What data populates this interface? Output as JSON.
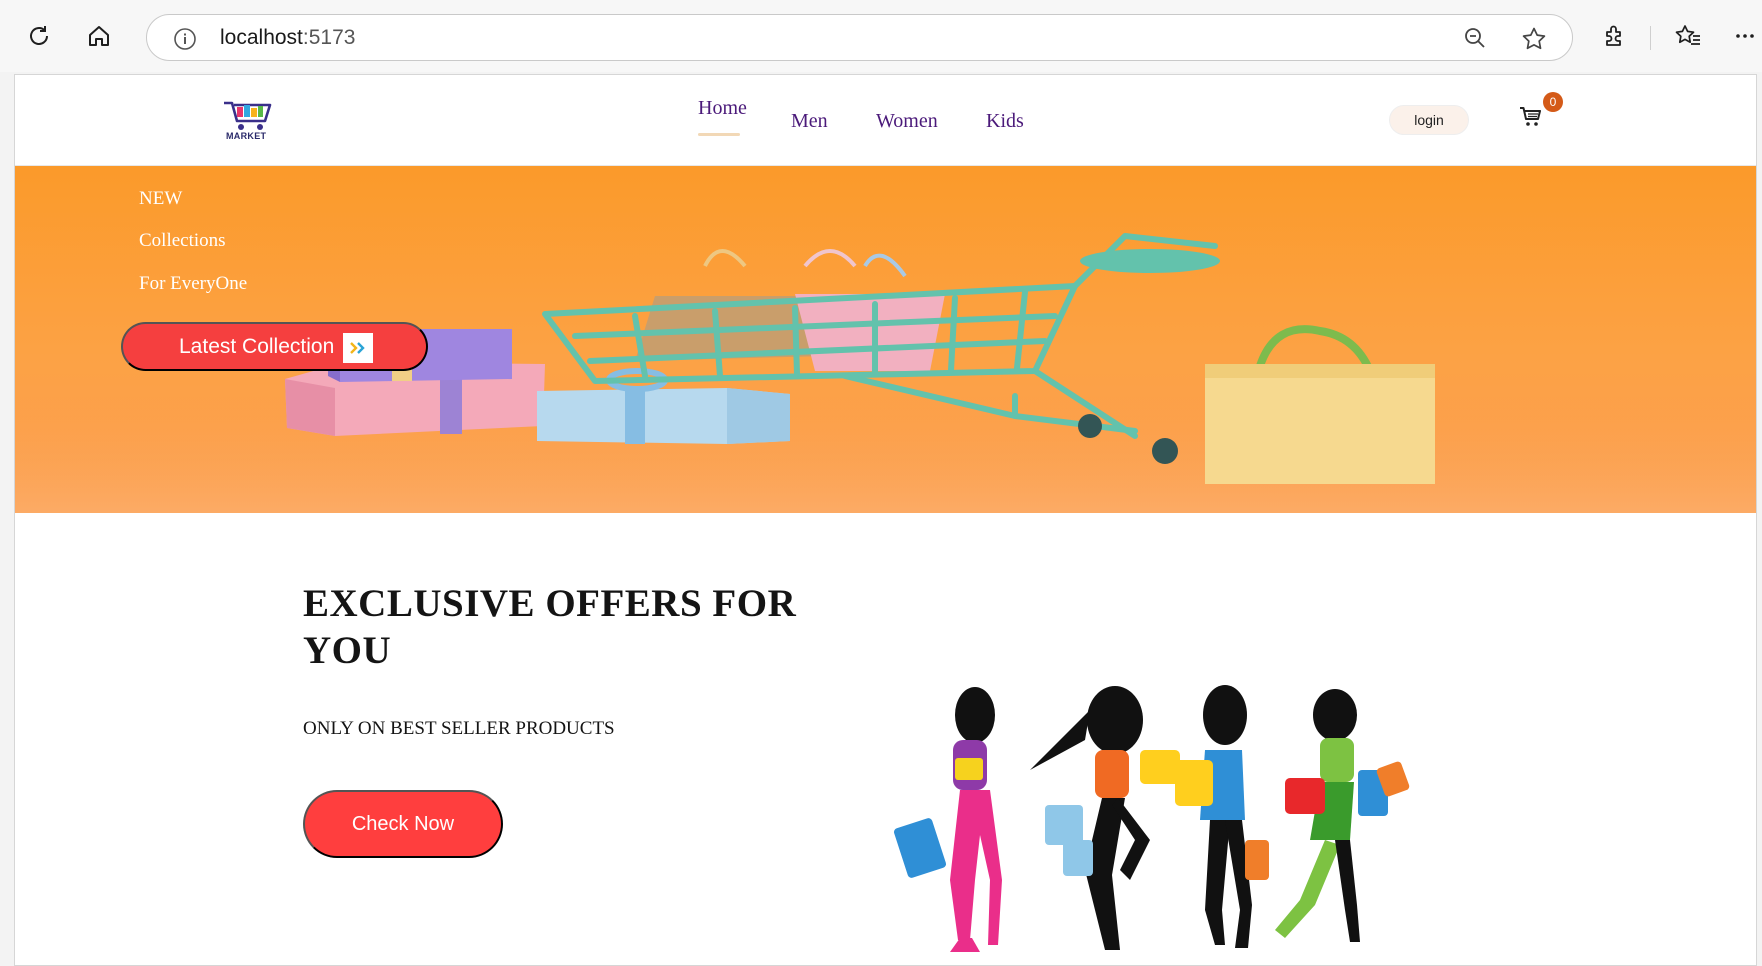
{
  "browser": {
    "url_host": "localhost",
    "url_port": ":5173",
    "icons": [
      "reload-icon",
      "home-icon",
      "info-icon",
      "zoom-out-icon",
      "favorite-star-icon",
      "extensions-icon",
      "favorites-icon",
      "more-icon"
    ]
  },
  "navbar": {
    "logo_text": "MARKET",
    "links": [
      "Home",
      "Men",
      "Women",
      "Kids"
    ],
    "active_link": "Home",
    "login_label": "login",
    "cart_count": "0"
  },
  "hero": {
    "line1": "NEW",
    "line2": "Collections",
    "line3": "For EveryOne",
    "button_label": "Latest Collection"
  },
  "offers": {
    "title": "EXCLUSIVE OFFERS FOR YOU",
    "subtitle": "ONLY ON BEST SELLER PRODUCTS",
    "button_label": "Check Now"
  },
  "colors": {
    "accent": "#f53f3f",
    "hero_orange": "#fb9a2a",
    "nav_text": "#4b1a7a",
    "cart_badge": "#d45a18"
  }
}
